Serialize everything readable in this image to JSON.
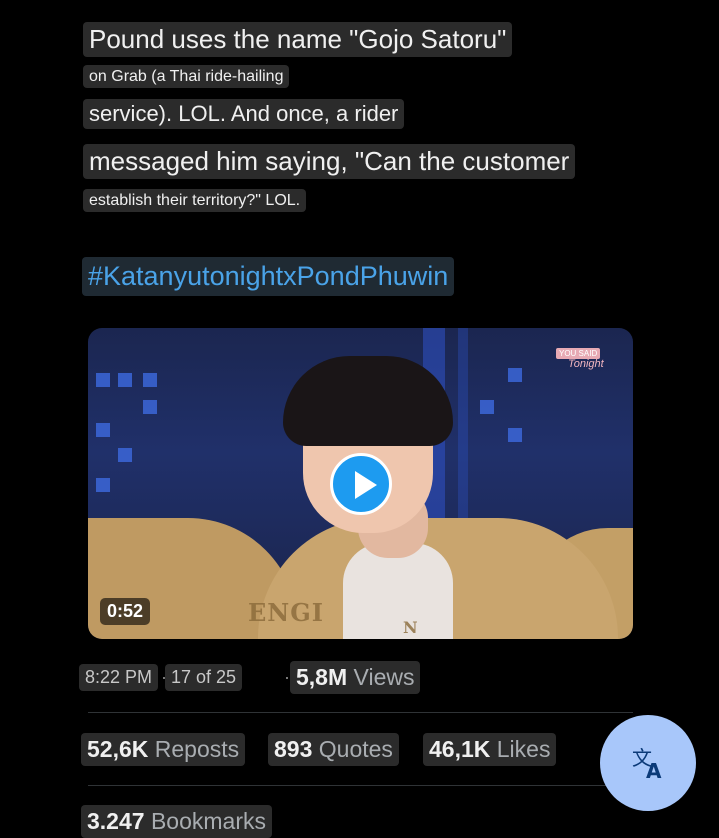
{
  "post": {
    "lines": [
      "Pound uses the name \"Gojo Satoru\"",
      "on Grab (a Thai ride-hailing",
      "service). LOL. And once, a rider",
      "messaged him saying, \"Can the customer",
      "establish their territory?\" LOL."
    ],
    "hashtag": "#KatanyutonightxPondPhuwin"
  },
  "video": {
    "duration": "0:52",
    "logo_top": "YOU SAID",
    "logo_script": "Tonight",
    "jacket_text": "ENGI",
    "jacket_text2": "N"
  },
  "meta": {
    "time": "8:22 PM",
    "sep": "·",
    "page": "17 of 25",
    "views_sep": "·",
    "views_count": "5,8M",
    "views_label": "Views"
  },
  "stats": {
    "reposts_count": "52,6K",
    "reposts_label": "Reposts",
    "quotes_count": "893",
    "quotes_label": "Quotes",
    "likes_count": "46,1K",
    "likes_label": "Likes",
    "bookmarks_count": "3.247",
    "bookmarks_label": "Bookmarks"
  },
  "fab": {
    "icon": "translate-icon"
  }
}
